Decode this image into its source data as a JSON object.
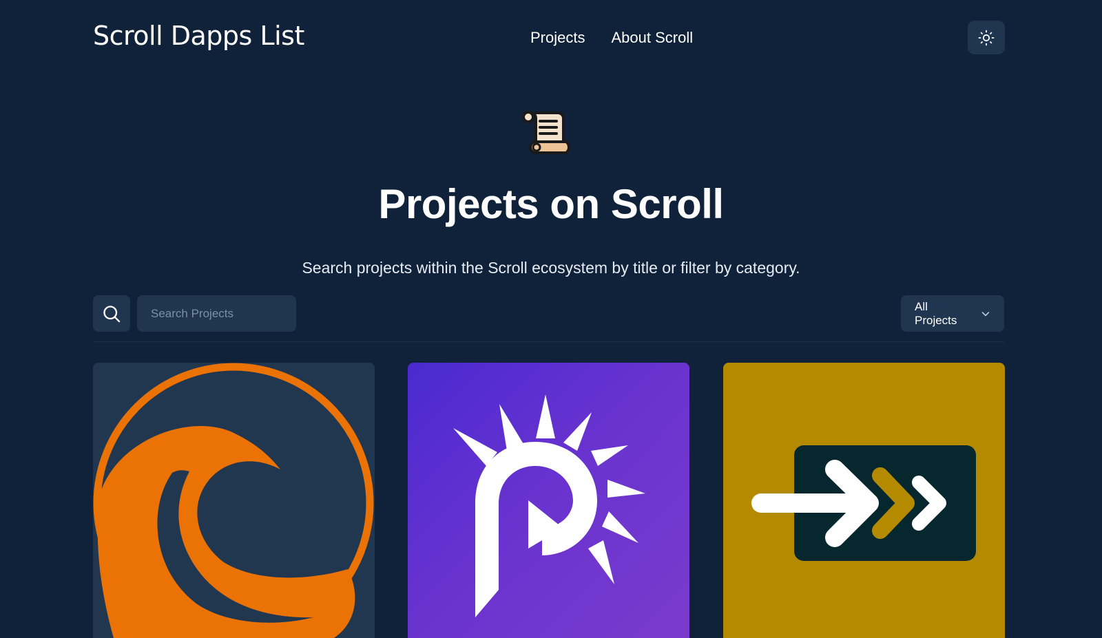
{
  "header": {
    "site_title": "Scroll Dapps List",
    "nav": [
      {
        "label": "Projects"
      },
      {
        "label": "About Scroll"
      }
    ],
    "theme_toggle_icon": "sun-icon"
  },
  "hero": {
    "icon": "scroll-emoji-icon",
    "title": "Projects on Scroll",
    "subtitle": "Search projects within the Scroll ecosystem by title or filter by category."
  },
  "search": {
    "button_icon": "search-icon",
    "placeholder": "Search Projects",
    "value": ""
  },
  "filter": {
    "selected": "All Projects",
    "icon": "chevron-down-icon"
  },
  "cards": [
    {
      "logo": "wave-logo",
      "background": "#213750",
      "accent": "#eb7205"
    },
    {
      "logo": "p-sunburst-logo",
      "background": "#5a2fd0",
      "accent": "#ffffff"
    },
    {
      "logo": "arrow-chevrons-logo",
      "background": "#b38a00",
      "accent": "#06272d"
    }
  ],
  "colors": {
    "page_background": "#10223a",
    "control_background": "#1f3550",
    "text": "#ffffff"
  }
}
